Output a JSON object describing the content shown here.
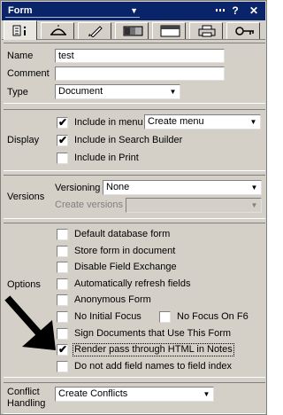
{
  "title": {
    "label": "Form"
  },
  "titlebar_icons": [
    "minimize-dots-icon",
    "help-icon",
    "close-icon"
  ],
  "tabs": [
    {
      "name": "tab-info",
      "icon": "info-icon",
      "active": true
    },
    {
      "name": "tab-defaults",
      "icon": "beanie-icon"
    },
    {
      "name": "tab-launch",
      "icon": "rocket-icon"
    },
    {
      "name": "tab-background",
      "icon": "gradient-icon"
    },
    {
      "name": "tab-header",
      "icon": "header-icon"
    },
    {
      "name": "tab-print",
      "icon": "printer-icon"
    },
    {
      "name": "tab-security",
      "icon": "key-icon"
    }
  ],
  "basics": {
    "name_label": "Name",
    "name_value": "test",
    "comment_label": "Comment",
    "comment_value": "",
    "type_label": "Type",
    "type_value": "Document"
  },
  "display": {
    "label": "Display",
    "include_menu": {
      "label": "Include in menu",
      "checked": true
    },
    "menu_combo": "Create menu",
    "include_search": {
      "label": "Include in Search Builder",
      "checked": true
    },
    "include_print": {
      "label": "Include in Print",
      "checked": false
    }
  },
  "versions": {
    "label": "Versions",
    "versioning_label": "Versioning",
    "versioning_value": "None",
    "create_label": "Create versions",
    "create_value": ""
  },
  "options": {
    "label": "Options",
    "items": [
      {
        "label": "Default database form",
        "checked": false
      },
      {
        "label": "Store form in document",
        "checked": false
      },
      {
        "label": "Disable Field Exchange",
        "checked": false
      },
      {
        "label": "Automatically refresh fields",
        "checked": false
      },
      {
        "label": "Anonymous Form",
        "checked": false
      },
      {
        "label": "No Initial Focus",
        "checked": false
      },
      {
        "label": "Sign Documents that Use This Form",
        "checked": false
      },
      {
        "label": "Render pass through HTML in Notes",
        "checked": true
      },
      {
        "label": "Do not add field names to field index",
        "checked": false
      }
    ],
    "no_focus_f6": {
      "label": "No Focus On F6",
      "checked": false
    }
  },
  "conflict": {
    "label_line1": "Conflict",
    "label_line2": "Handling",
    "value": "Create Conflicts"
  }
}
